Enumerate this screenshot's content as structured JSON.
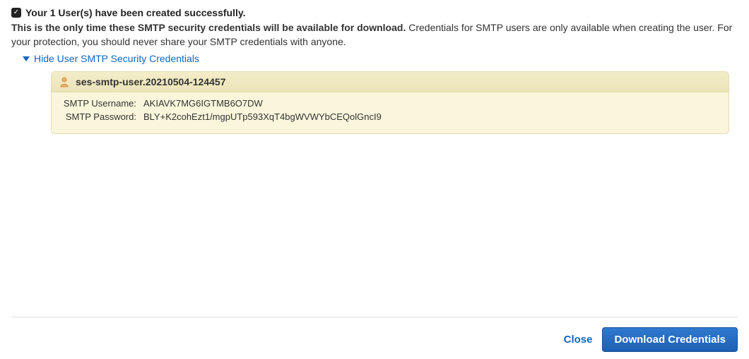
{
  "header": {
    "success_text": "Your 1 User(s) have been created successfully.",
    "info_bold": "This is the only time these SMTP security credentials will be available for download.",
    "info_rest": " Credentials for SMTP users are only available when creating the user. For your protection, you should never share your SMTP credentials with anyone."
  },
  "toggle": {
    "label": "Hide User SMTP Security Credentials"
  },
  "panel": {
    "title": "ses-smtp-user.20210504-124457",
    "username_label": "SMTP Username:",
    "username_value": "AKIAVK7MG6IGTMB6O7DW",
    "password_label": "SMTP Password:",
    "password_value": "BLY+K2cohEzt1/mgpUTp593XqT4bgWVWYbCEQolGncI9"
  },
  "footer": {
    "close": "Close",
    "download": "Download Credentials"
  }
}
